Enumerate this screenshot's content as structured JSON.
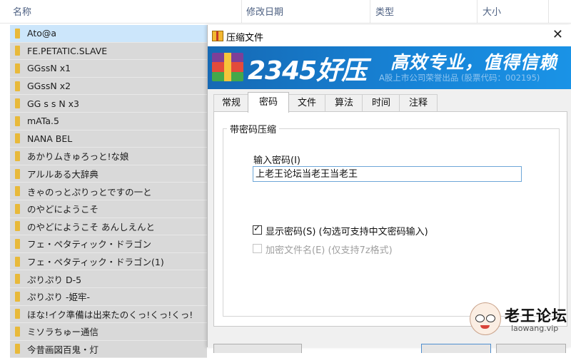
{
  "explorer": {
    "columns": {
      "name": "名称",
      "modified": "修改日期",
      "type": "类型",
      "size": "大小"
    },
    "sort_indicator": "^",
    "files": [
      "Ato@a",
      "FE.PETATIC.SLAVE",
      "GGssN x1",
      "GGssN x2",
      "GG s s N x3",
      "mATa.5",
      "NANA BEL",
      "あかりムきゅろっと!な娘",
      "アルルある大辞典",
      "きゃのっとぷりっとですの一と",
      "のやどにようこそ",
      "のやどにようこそ あんしえんと",
      "フェ・ペタティック・ドラゴン",
      "フェ・ペタティック・ドラゴン(1)",
      "ぷりぷり D-5",
      "ぷりぷり -姫牢-",
      "ほな!イク準備は出来たのくっ!くっ!くっ!",
      "ミソラちゅー通信",
      "今昔画図百鬼・灯"
    ],
    "selected_index": 0
  },
  "dialog": {
    "title": "压缩文件",
    "close_label": "✕",
    "banner": {
      "brand": "2345好压",
      "slogan": "高效专业，值得信赖",
      "subslogan": "A股上市公司荣誉出品 (股票代码：002195)"
    },
    "tabs": [
      "常规",
      "密码",
      "文件",
      "算法",
      "时间",
      "注释"
    ],
    "active_tab": "密码",
    "group_title": "带密码压缩",
    "password_label": "输入密码(I)",
    "password_value": "上老王论坛当老王当老王",
    "show_password": {
      "label": "显示密码(S)  (勾选可支持中文密码输入)",
      "checked": true
    },
    "encrypt_names": {
      "label": "加密文件名(E)  (仅支持7z格式)",
      "checked": false,
      "enabled": false
    }
  },
  "watermark": {
    "title": "老王论坛",
    "url": "laowang.vip"
  },
  "colors": {
    "banner": "#1783d6",
    "selection": "#cce6fb",
    "folder": "#e8b93a"
  }
}
